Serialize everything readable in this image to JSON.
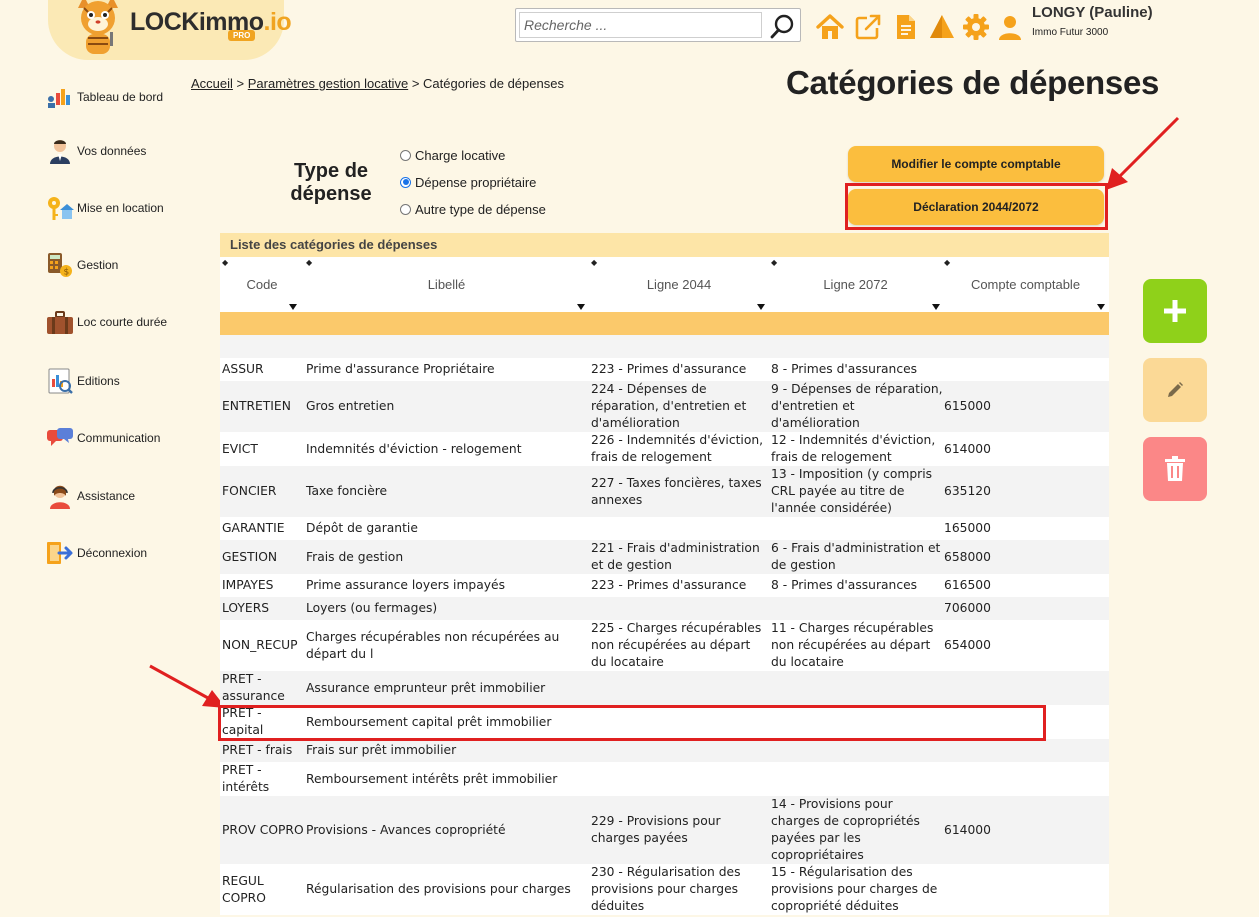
{
  "header": {
    "logo_main": "LOCKimmo",
    "logo_suffix": ".io",
    "logo_badge": "PRO",
    "search_placeholder": "Recherche ...",
    "icons": [
      "home-icon",
      "external-link-icon",
      "document-icon",
      "alert-icon",
      "gear-icon",
      "user-icon"
    ],
    "user_name": "LONGY (Pauline)",
    "user_company": "Immo Futur 3000"
  },
  "sidebar": {
    "items": [
      {
        "label": "Tableau de bord",
        "icon": "dashboard-icon"
      },
      {
        "label": "Vos données",
        "icon": "person-icon"
      },
      {
        "label": "Mise en location",
        "icon": "key-house-icon"
      },
      {
        "label": "Gestion",
        "icon": "calculator-icon"
      },
      {
        "label": "Loc courte durée",
        "icon": "suitcase-icon"
      },
      {
        "label": "Editions",
        "icon": "report-icon"
      },
      {
        "label": "Communication",
        "icon": "chat-icon"
      },
      {
        "label": "Assistance",
        "icon": "support-icon"
      },
      {
        "label": "Déconnexion",
        "icon": "logout-icon"
      }
    ]
  },
  "breadcrumb": {
    "home": "Accueil",
    "sep1": ">",
    "parent": "Paramètres gestion locative",
    "sep2": ">",
    "current": "Catégories de dépenses"
  },
  "page_title": "Catégories de dépenses",
  "type_depense": {
    "label": "Type de dépense",
    "options": [
      {
        "label": "Charge locative",
        "checked": false
      },
      {
        "label": "Dépense propriétaire",
        "checked": true
      },
      {
        "label": "Autre type de dépense",
        "checked": false
      }
    ]
  },
  "buttons": {
    "modify_account": "Modifier le compte comptable",
    "declaration": "Déclaration 2044/2072"
  },
  "table": {
    "caption": "Liste des catégories de dépenses",
    "columns": [
      "Code",
      "Libellé",
      "Ligne 2044",
      "Ligne 2072",
      "Compte comptable"
    ],
    "rows": [
      {
        "code": "ASSUR",
        "libelle": "Prime d'assurance Propriétaire",
        "l2044": "223 - Primes d'assurance",
        "l2072": "8 - Primes d'assurances",
        "compte": ""
      },
      {
        "code": "ENTRETIEN",
        "libelle": "Gros entretien",
        "l2044": "224 - Dépenses de réparation, d'entretien et d'amélioration",
        "l2072": "9 - Dépenses de réparation, d'entretien et d'amélioration",
        "compte": "615000"
      },
      {
        "code": "EVICT",
        "libelle": "Indemnités d'éviction - relogement",
        "l2044": "226 - Indemnités d'éviction, frais de relogement",
        "l2072": "12 - Indemnités d'éviction, frais de relogement",
        "compte": "614000"
      },
      {
        "code": "FONCIER",
        "libelle": "Taxe foncière",
        "l2044": "227 - Taxes foncières, taxes annexes",
        "l2072": "13 - Imposition (y compris CRL payée au titre de l'année considérée)",
        "compte": "635120"
      },
      {
        "code": "GARANTIE",
        "libelle": "Dépôt de garantie",
        "l2044": "",
        "l2072": "",
        "compte": "165000"
      },
      {
        "code": "GESTION",
        "libelle": "Frais de gestion",
        "l2044": "221 - Frais d'administration et de gestion",
        "l2072": "6 - Frais d'administration et de gestion",
        "compte": "658000"
      },
      {
        "code": "IMPAYES",
        "libelle": "Prime assurance loyers impayés",
        "l2044": "223 - Primes d'assurance",
        "l2072": "8 - Primes d'assurances",
        "compte": "616500"
      },
      {
        "code": "LOYERS",
        "libelle": "Loyers (ou fermages)",
        "l2044": "",
        "l2072": "",
        "compte": "706000"
      },
      {
        "code": "NON_RECUP",
        "libelle": "Charges récupérables non récupérées au départ du l",
        "l2044": "225 - Charges récupérables non récupérées au départ du locataire",
        "l2072": "11 - Charges récupérables non récupérées au départ du locataire",
        "compte": "654000"
      },
      {
        "code": "PRET - assurance",
        "libelle": "Assurance emprunteur prêt immobilier",
        "l2044": "",
        "l2072": "",
        "compte": ""
      },
      {
        "code": "PRET - capital",
        "libelle": "Remboursement capital prêt immobilier",
        "l2044": "",
        "l2072": "",
        "compte": ""
      },
      {
        "code": "PRET - frais",
        "libelle": "Frais sur prêt immobilier",
        "l2044": "",
        "l2072": "",
        "compte": ""
      },
      {
        "code": "PRET - intérêts",
        "libelle": "Remboursement intérêts prêt immobilier",
        "l2044": "",
        "l2072": "",
        "compte": ""
      },
      {
        "code": "PROV COPRO",
        "libelle": "Provisions - Avances copropriété",
        "l2044": "229 - Provisions pour charges payées",
        "l2072": "14 - Provisions pour charges de copropriétés payées par les copropriétaires",
        "compte": "614000"
      },
      {
        "code": "REGUL COPRO",
        "libelle": "Régularisation des provisions pour charges",
        "l2044": "230 - Régularisation des provisions pour charges déduites",
        "l2072": "15 - Régularisation des provisions pour charges de copropriété déduites",
        "compte": ""
      }
    ]
  },
  "actions": {
    "add_icon": "plus-icon",
    "edit_icon": "pencil-icon",
    "delete_icon": "trash-icon"
  },
  "colors": {
    "background": "#fdf7e6",
    "accent_yellow": "#fbbe3e",
    "caption_bg": "#fde5a7",
    "filter_row": "#fbc96b",
    "add_green": "#8fd11a",
    "edit_beige": "#fbd996",
    "delete_pink": "#fb8787",
    "highlight_red": "#e02020",
    "link_orange": "#f0a421"
  }
}
